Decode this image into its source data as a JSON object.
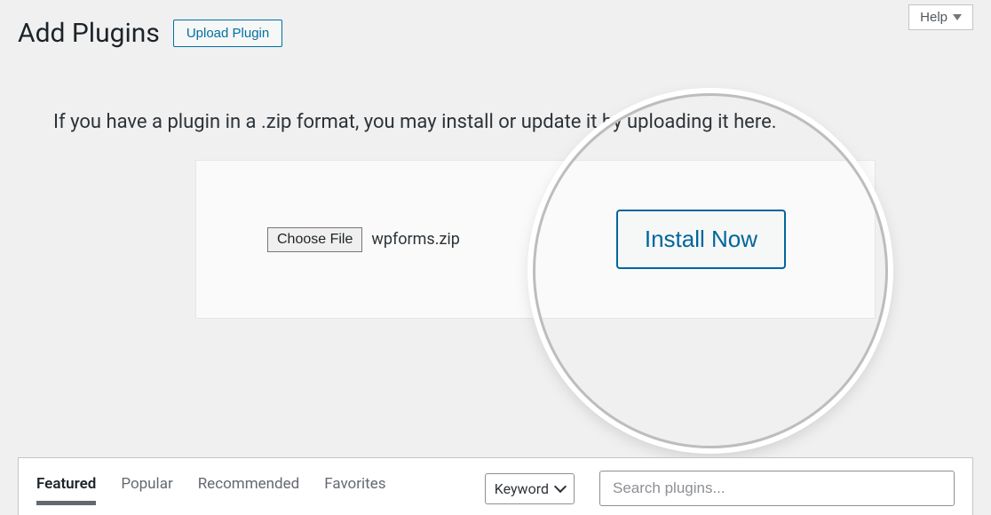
{
  "header": {
    "title": "Add Plugins",
    "upload_button_label": "Upload Plugin",
    "help_label": "Help"
  },
  "upload": {
    "instruction": "If you have a plugin in a .zip format, you may install or update it by uploading it here.",
    "choose_file_label": "Choose File",
    "selected_file": "wpforms.zip",
    "install_now_label": "Install Now"
  },
  "tabs": {
    "featured": "Featured",
    "popular": "Popular",
    "recommended": "Recommended",
    "favorites": "Favorites"
  },
  "search": {
    "keyword_label": "Keyword",
    "placeholder": "Search plugins..."
  }
}
